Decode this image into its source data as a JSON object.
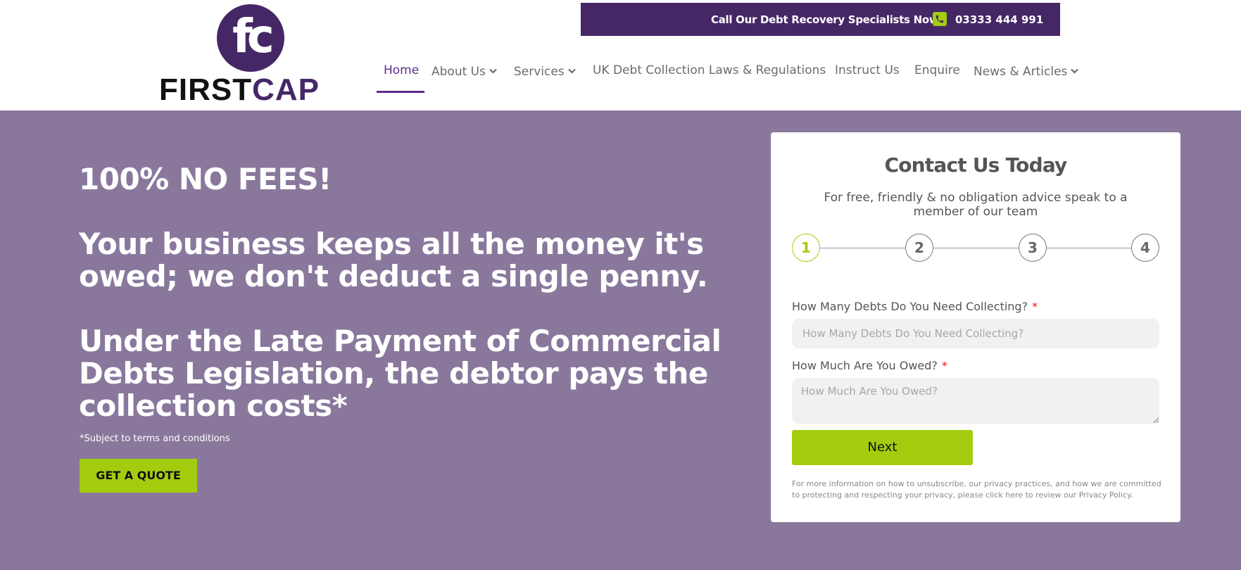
{
  "brand": {
    "logo_mark": "fc",
    "logo_word_1": "FIRST",
    "logo_word_2": "CAP",
    "primary_color": "#452766",
    "accent_color": "#a4cc0f",
    "hero_bg": "#89789c"
  },
  "topbar": {
    "call_text": "Call Our Debt Recovery Specialists Now",
    "phone_icon": "phone-icon",
    "phone_number": "03333 444 991"
  },
  "nav": {
    "items": [
      {
        "label": "Home",
        "active": true,
        "dropdown": false
      },
      {
        "label": "About Us",
        "active": false,
        "dropdown": true
      },
      {
        "label": "Services",
        "active": false,
        "dropdown": true
      },
      {
        "label": "UK Debt Collection Laws & Regulations",
        "active": false,
        "dropdown": false
      },
      {
        "label": "Instruct Us",
        "active": false,
        "dropdown": false
      },
      {
        "label": "Enquire",
        "active": false,
        "dropdown": false
      },
      {
        "label": "News & Articles",
        "active": false,
        "dropdown": true
      }
    ]
  },
  "hero": {
    "headline_1": "100% NO FEES!",
    "headline_2_line_1": "Your business keeps all the money it's",
    "headline_2_line_2": "owed; we don't deduct a single penny.",
    "headline_3_line_1": "Under the Late Payment of Commercial",
    "headline_3_line_2": "Debts Legislation, the debtor pays the",
    "headline_3_line_3": "collection costs*",
    "terms": "*Subject to terms and conditions",
    "cta_label": "GET A QUOTE"
  },
  "form": {
    "title": "Contact Us Today",
    "subtitle": "For free, friendly & no obligation advice speak to a member of our team",
    "steps": [
      "1",
      "2",
      "3",
      "4"
    ],
    "current_step": 1,
    "field_1": {
      "label": "How Many Debts Do You Need Collecting?",
      "required_mark": "*",
      "placeholder": "How Many Debts Do You Need Collecting?"
    },
    "field_2": {
      "label": "How Much Are You Owed?",
      "required_mark": "*",
      "placeholder": "How Much Are You Owed?"
    },
    "next_label": "Next",
    "footnote": "For more information on how to unsubscribe, our privacy practices, and how we are committed to protecting and respecting your privacy, please click here to review our Privacy Policy."
  }
}
